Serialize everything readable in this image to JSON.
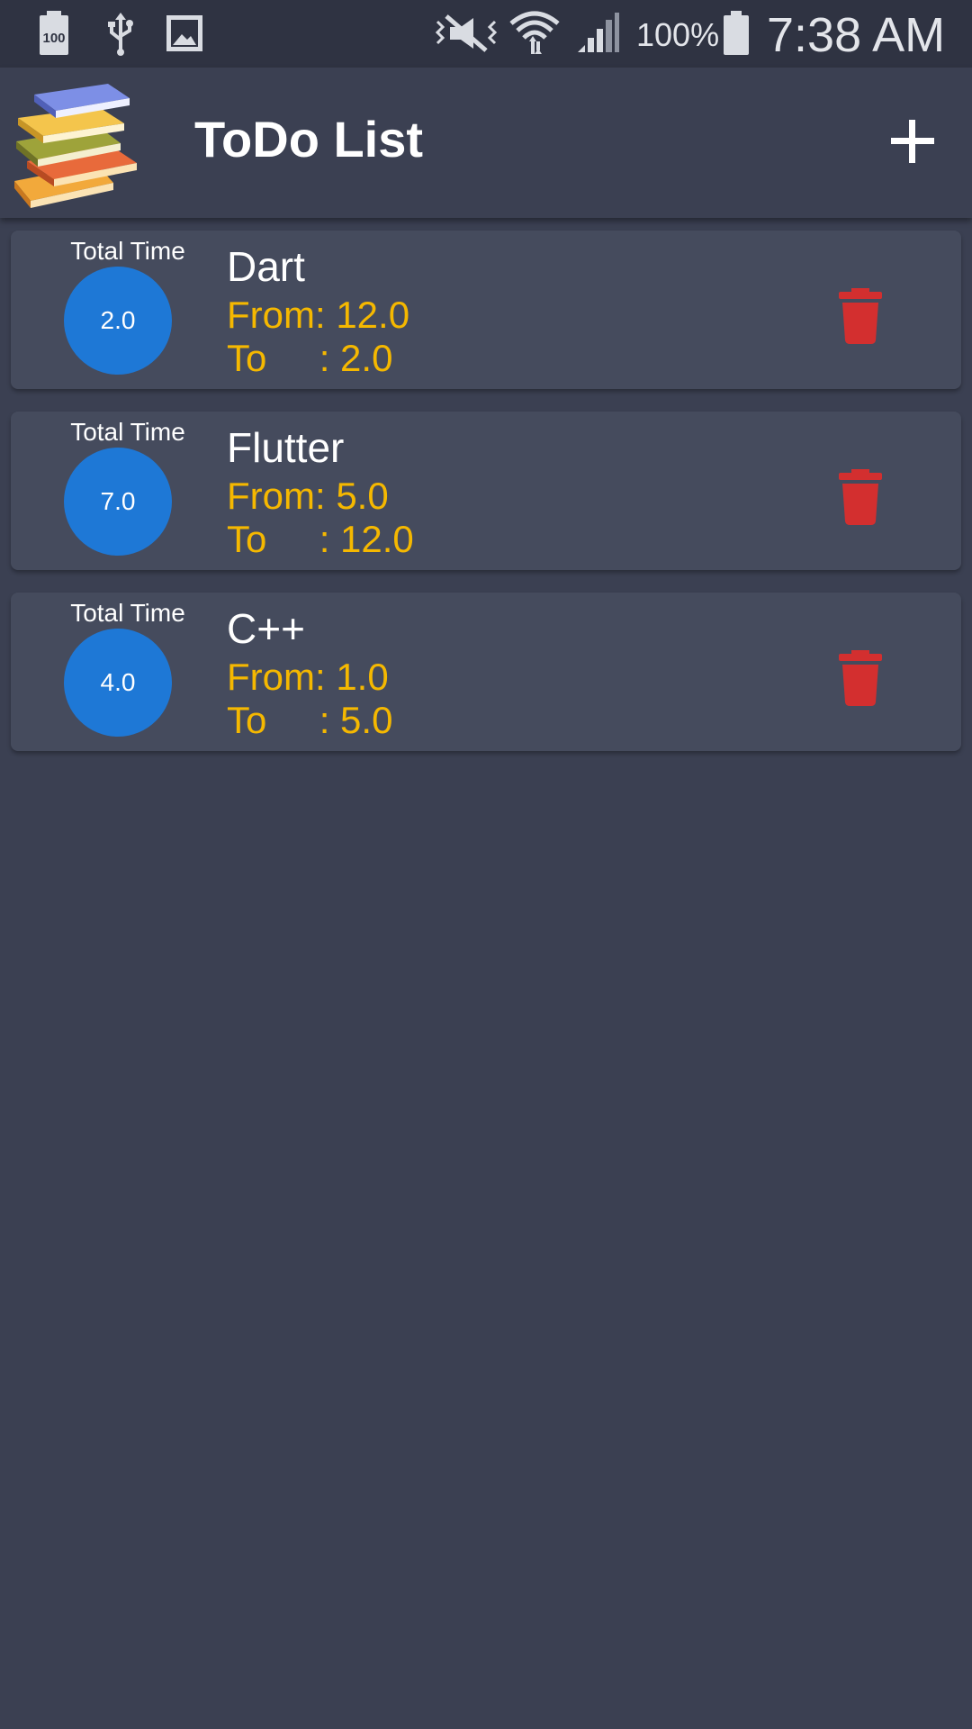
{
  "status_bar": {
    "battery_notice_text": "100",
    "battery_percent": "100%",
    "time": "7:38 AM",
    "icons": [
      "battery-notification-icon",
      "usb-icon",
      "image-icon",
      "vibrate-mute-icon",
      "wifi-icon",
      "cell-signal-icon",
      "battery-icon"
    ]
  },
  "app_bar": {
    "title": "ToDo List",
    "logo_icon": "books-stack-icon",
    "add_icon": "plus-icon"
  },
  "colors": {
    "background": "#3b4052",
    "card": "#454b5d",
    "accent_circle": "#1e78d6",
    "time_text": "#f5b800",
    "delete": "#d32f2f"
  },
  "todos": [
    {
      "total_label": "Total Time",
      "total": "2.0",
      "title": "Dart",
      "from": "From: 12.0",
      "to": "To     : 2.0"
    },
    {
      "total_label": "Total Time",
      "total": "7.0",
      "title": "Flutter",
      "from": "From: 5.0",
      "to": "To     : 12.0"
    },
    {
      "total_label": "Total Time",
      "total": "4.0",
      "title": "C++",
      "from": "From: 1.0",
      "to": "To     : 5.0"
    }
  ]
}
